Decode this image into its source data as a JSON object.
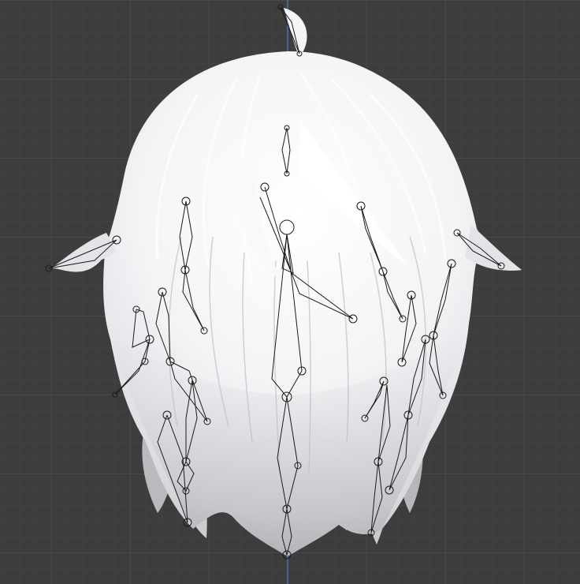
{
  "viewport": {
    "background_color": "#3d3d3d",
    "grid_minor_color": "#474747",
    "grid_major_color": "#525252",
    "vertical_axis_color": "#4a7fd6",
    "hair_color": "#f2f3f5",
    "bone_color": "#1a1a1a",
    "model": "hair-mesh",
    "overlay": "armature-bones"
  }
}
